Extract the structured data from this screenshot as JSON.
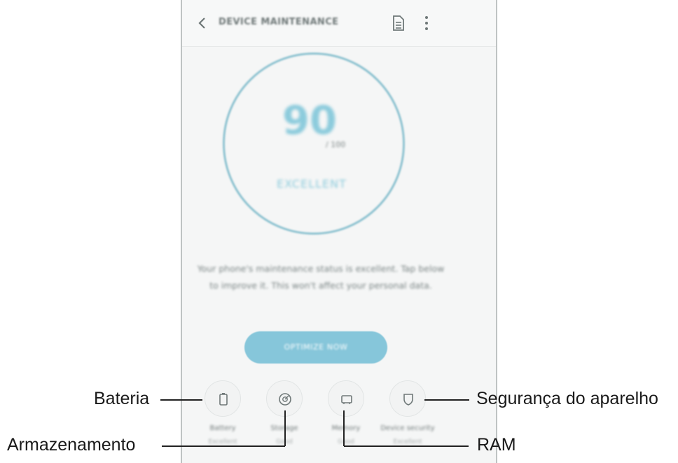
{
  "header": {
    "title": "DEVICE MAINTENANCE",
    "icons": [
      "back-arrow-icon",
      "document-icon",
      "more-options-icon"
    ]
  },
  "score": {
    "value": "90",
    "max_label": "/ 100",
    "status": "EXCELLENT"
  },
  "description": "Your phone's maintenance status is excellent. Tap below to improve it. This won't affect your personal data.",
  "optimize_button": "OPTIMIZE NOW",
  "tiles": [
    {
      "label": "Battery",
      "sub": "Excellent",
      "icon": "battery-icon"
    },
    {
      "label": "Storage",
      "sub": "Good",
      "icon": "storage-icon"
    },
    {
      "label": "Memory",
      "sub": "Good",
      "icon": "memory-icon"
    },
    {
      "label": "Device security",
      "sub": "Excellent",
      "icon": "shield-icon"
    }
  ],
  "callouts": {
    "battery": "Bateria",
    "storage": "Armazenamento",
    "security": "Segurança do aparelho",
    "ram": "RAM"
  },
  "colors": {
    "accent": "#86c6da",
    "ring": "#8dc2d0",
    "background": "#f5f6f6"
  }
}
